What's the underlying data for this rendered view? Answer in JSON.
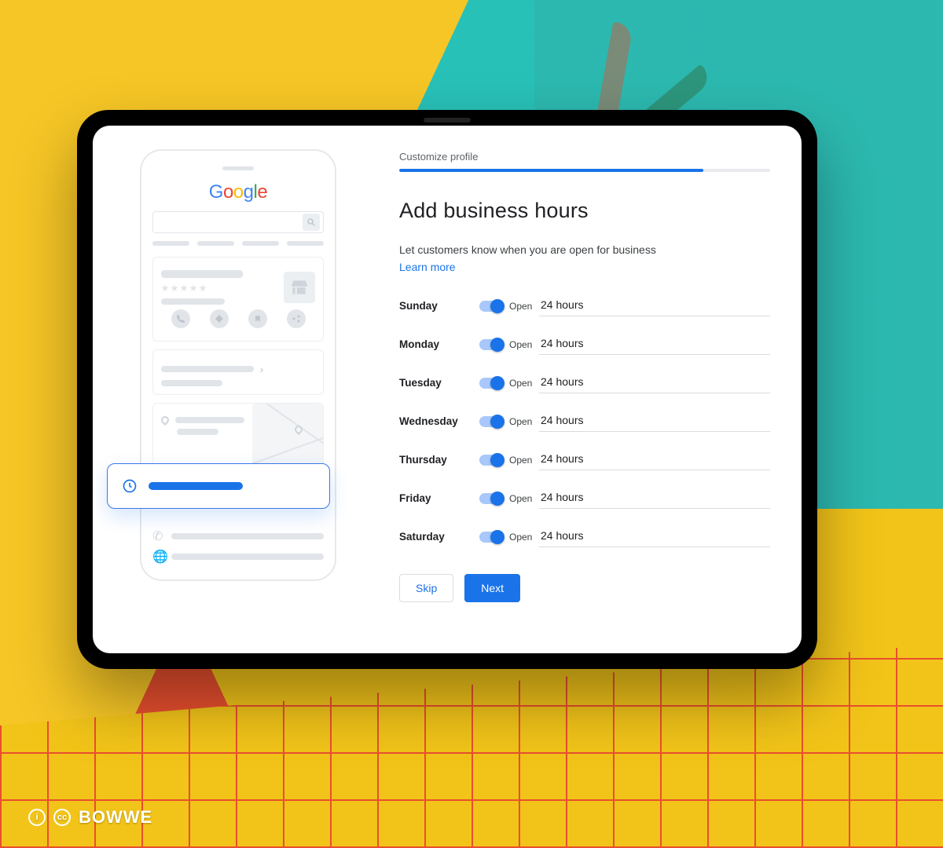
{
  "step_label": "Customize profile",
  "progress_pct": 82,
  "heading": "Add business hours",
  "subtext": "Let customers know when you are open for business",
  "learn_more": "Learn more",
  "open_label": "Open",
  "days": [
    {
      "name": "Sunday",
      "open": true,
      "hours": "24 hours"
    },
    {
      "name": "Monday",
      "open": true,
      "hours": "24 hours"
    },
    {
      "name": "Tuesday",
      "open": true,
      "hours": "24 hours"
    },
    {
      "name": "Wednesday",
      "open": true,
      "hours": "24 hours"
    },
    {
      "name": "Thursday",
      "open": true,
      "hours": "24 hours"
    },
    {
      "name": "Friday",
      "open": true,
      "hours": "24 hours"
    },
    {
      "name": "Saturday",
      "open": true,
      "hours": "24 hours"
    }
  ],
  "buttons": {
    "skip": "Skip",
    "next": "Next"
  },
  "phone_logo": {
    "g1": "G",
    "o1": "o",
    "o2": "o",
    "g2": "g",
    "l": "l",
    "e": "e"
  },
  "watermark": {
    "info": "i",
    "cc": "cc",
    "brand": "BOWWE"
  }
}
